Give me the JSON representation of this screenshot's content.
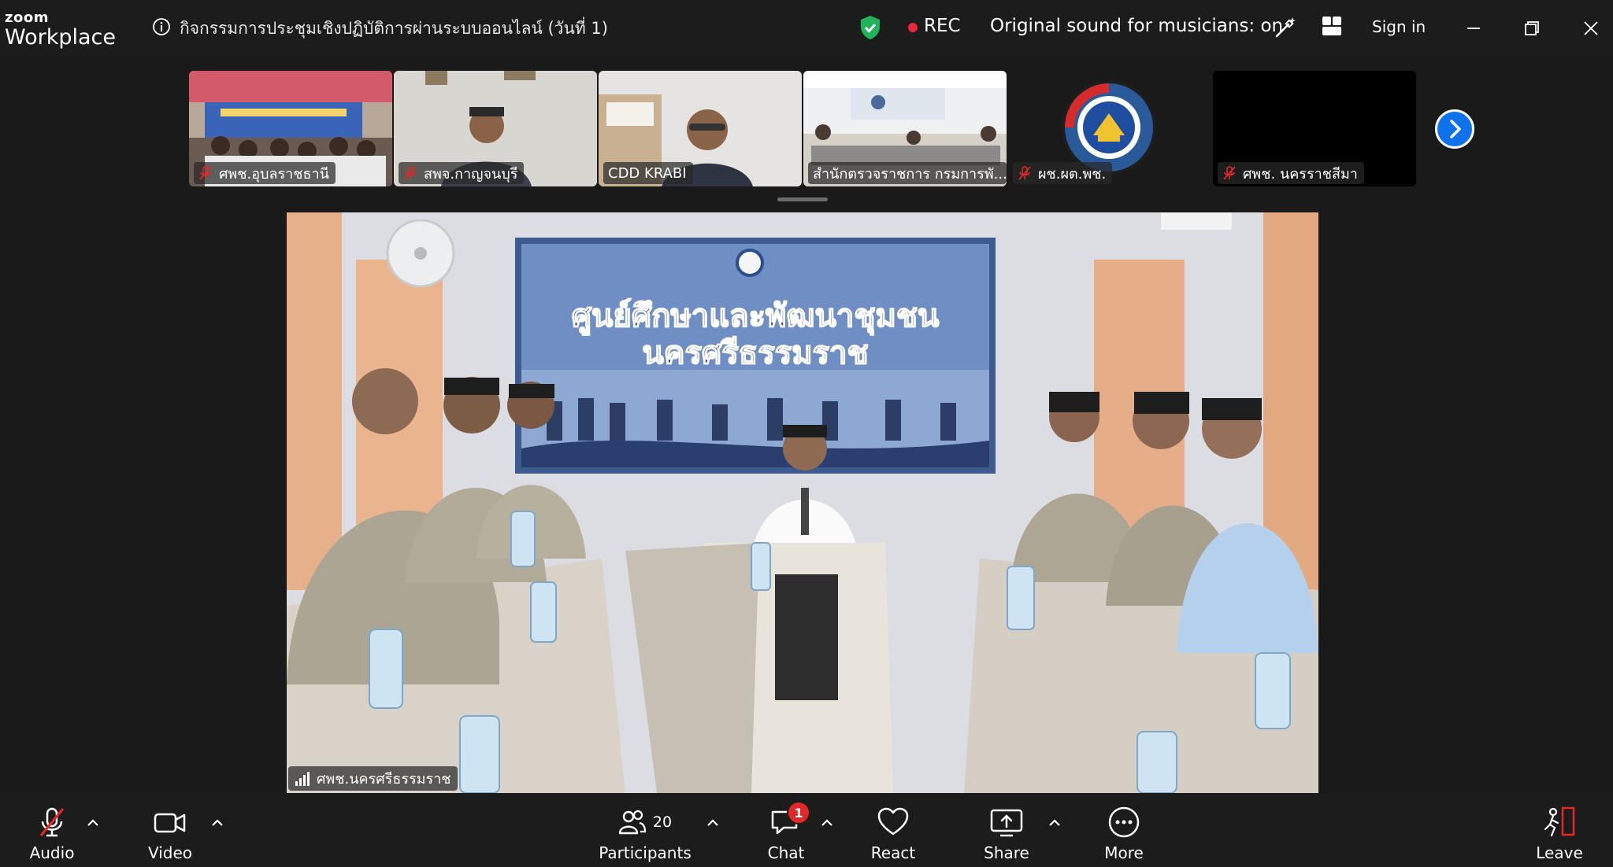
{
  "app": {
    "brand_top": "zoom",
    "brand_bottom": "Workplace"
  },
  "header": {
    "meeting_title": "กิจกรรมการประชุมเชิงปฏิบัติการผ่านระบบออนไลน์ (วันที่ 1)",
    "rec_label": "REC",
    "original_sound": "Original sound for musicians: on",
    "sign_in": "Sign in"
  },
  "participants_strip": [
    {
      "name": "ศพช.อุบลราชธานี",
      "muted": true
    },
    {
      "name": "สพจ.กาญจนบุรี",
      "muted": true
    },
    {
      "name": "CDD KRABI",
      "muted": false
    },
    {
      "name": "สำนักตรวจราชการ กรมการพั...",
      "muted": false
    },
    {
      "name": "ผช.ผต.พช.",
      "muted": true
    },
    {
      "name": "ศพช. นครราชสีมา",
      "muted": true
    }
  ],
  "main_video": {
    "speaker_name": "ศพช.นครศรีธรรมราช",
    "banner_line1": "ศูนย์ศึกษาและพัฒนาชุมชน",
    "banner_line2": "นครศรีธรรมราช"
  },
  "toolbar": {
    "audio": "Audio",
    "video": "Video",
    "participants": "Participants",
    "participants_count": "20",
    "chat": "Chat",
    "chat_badge": "1",
    "react": "React",
    "share": "Share",
    "more": "More",
    "leave": "Leave"
  },
  "colors": {
    "accent": "#0e72ed",
    "rec": "#e8273a",
    "secure": "#20b35a",
    "leave": "#e02828"
  }
}
